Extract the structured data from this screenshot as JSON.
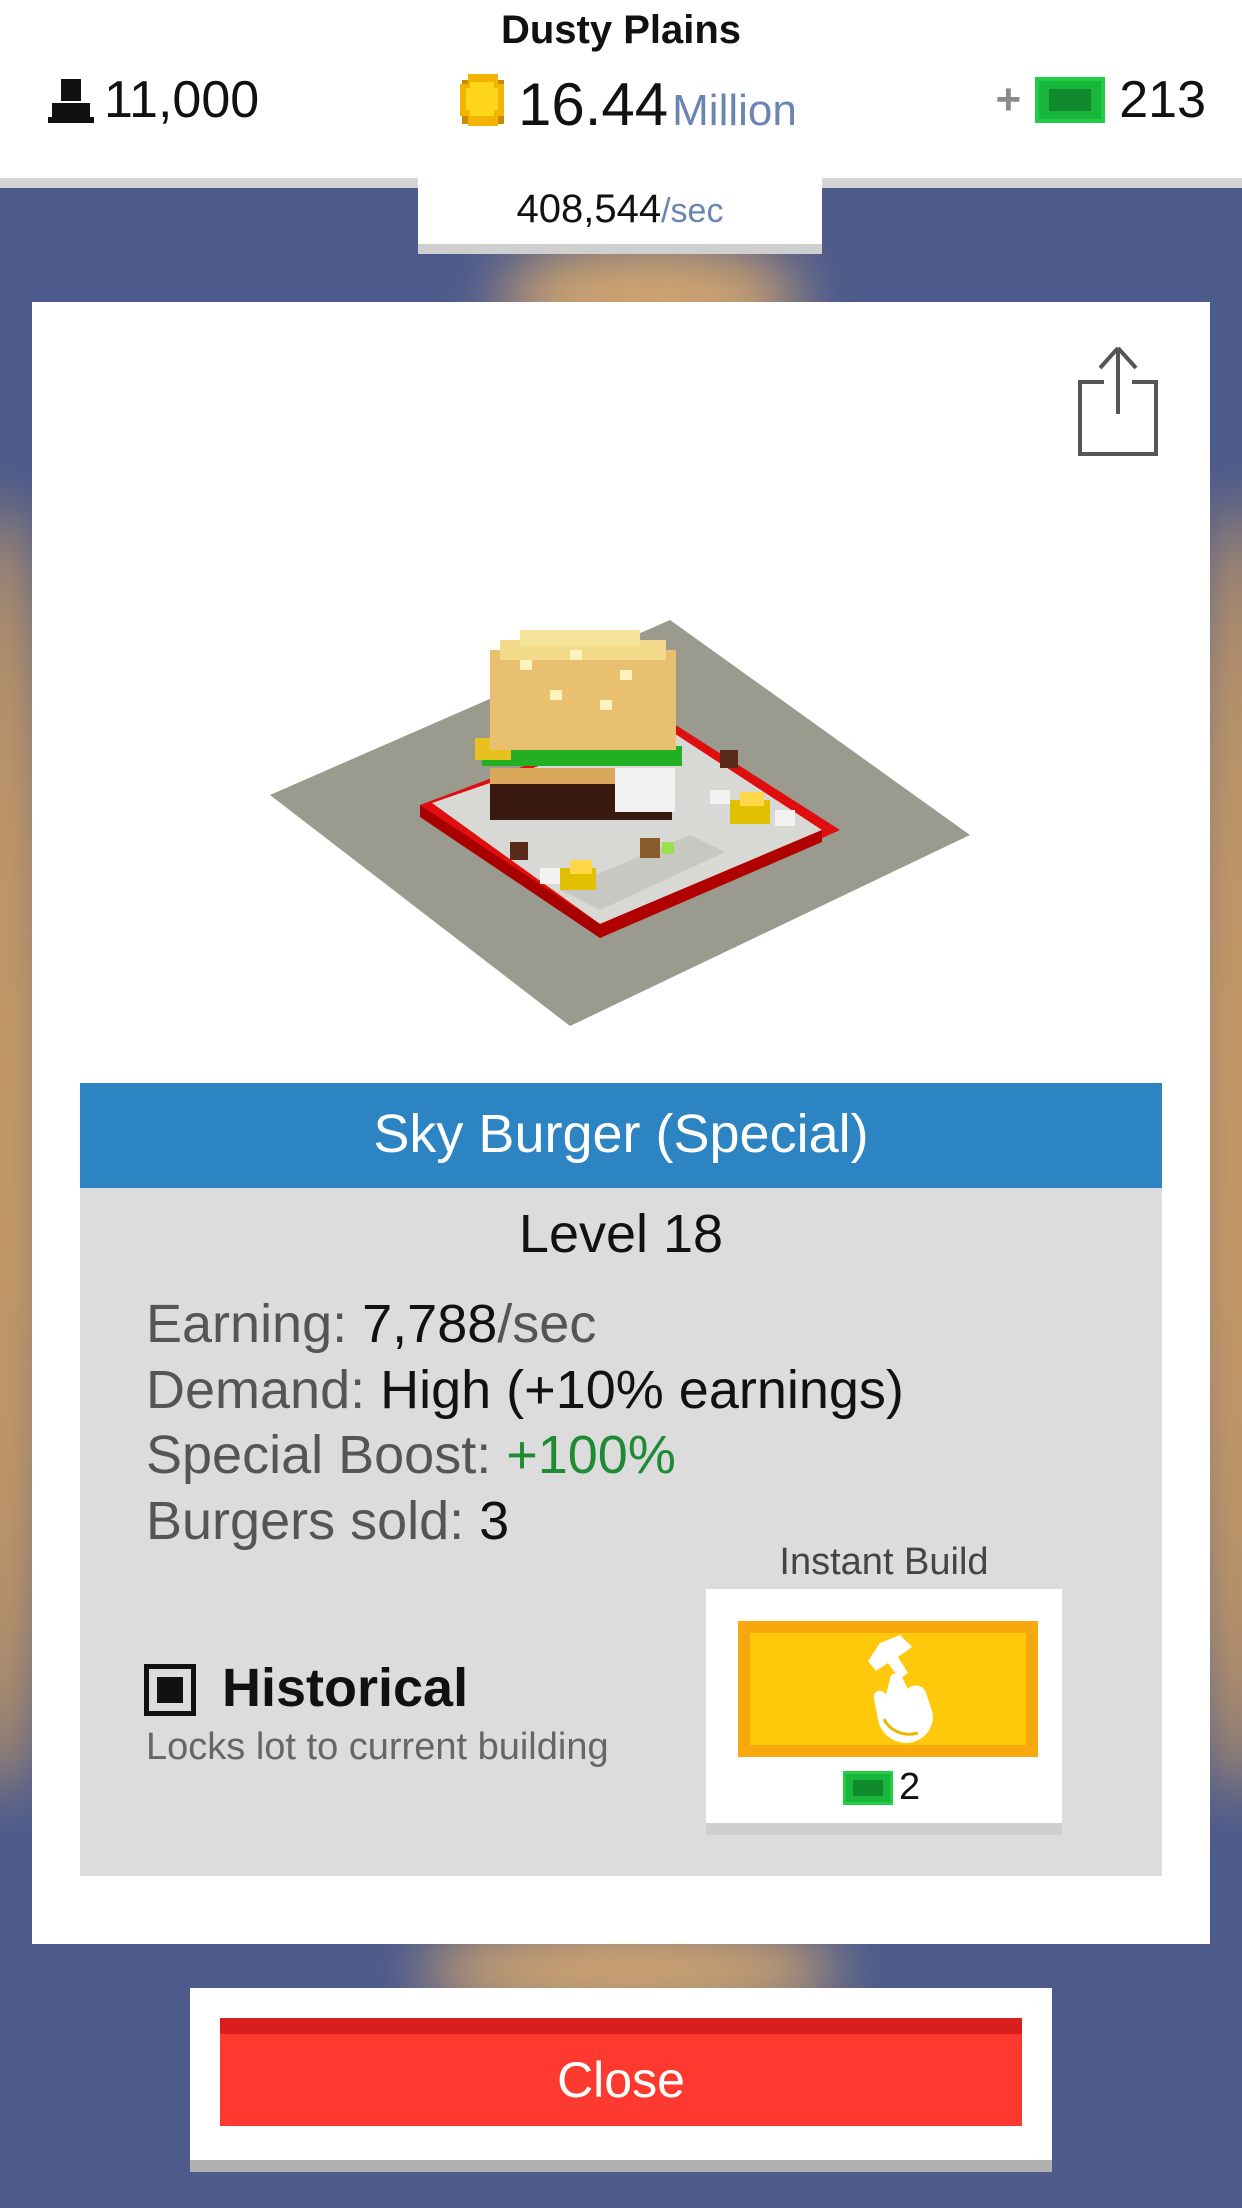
{
  "header": {
    "city_name": "Dusty Plains",
    "population": "11,000",
    "money_value": "16.44",
    "money_unit": "Million",
    "bucks_plus": "+",
    "bucks": "213",
    "income_rate": "408,544",
    "income_unit": "/sec"
  },
  "building": {
    "title": "Sky Burger (Special)",
    "level": "Level 18",
    "stats": [
      {
        "label": "Earning: ",
        "value": "7,788",
        "unit": "/sec"
      },
      {
        "label": "Demand: ",
        "value": "High (+10% earnings)"
      },
      {
        "label": "Special Boost: ",
        "value": "+100%"
      },
      {
        "label": "Burgers sold: ",
        "value": "3"
      }
    ],
    "historical_label": "Historical",
    "historical_desc": "Locks lot to current building",
    "historical_checked": true
  },
  "instant_build": {
    "label": "Instant Build",
    "cost": "2"
  },
  "close_label": "Close",
  "colors": {
    "background": "#4c5b8c",
    "title_bar": "#2d84c2",
    "close_button": "#fe3a30",
    "instant_build": "#ffc80a",
    "boost_green": "#1f8a34"
  },
  "icons": [
    "person-icon",
    "coin-icon",
    "cash-icon",
    "share-icon",
    "hammer-hand-icon",
    "checkbox-icon"
  ]
}
